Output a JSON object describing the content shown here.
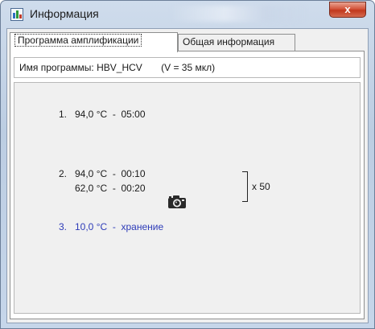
{
  "window": {
    "title": "Информация",
    "close_label": "x"
  },
  "tabs": [
    {
      "label": "Программа амплификации",
      "active": true
    },
    {
      "label": "Общая информация",
      "active": false
    }
  ],
  "program": {
    "name_label": "Имя программы:",
    "name_value": "HBV_HCV",
    "volume": "(V = 35 мкл)"
  },
  "steps": [
    {
      "number": "1.",
      "line1": "94,0 °C  -  05:00"
    },
    {
      "number": "2.",
      "line1": "94,0 °C  -  00:10",
      "line2": "62,0 °C  -  00:20",
      "cycles": "x 50",
      "icon": "camera-icon"
    },
    {
      "number": "3.",
      "line1": "10,0 °C  -  хранение",
      "color": "#2d3bb8"
    }
  ]
}
